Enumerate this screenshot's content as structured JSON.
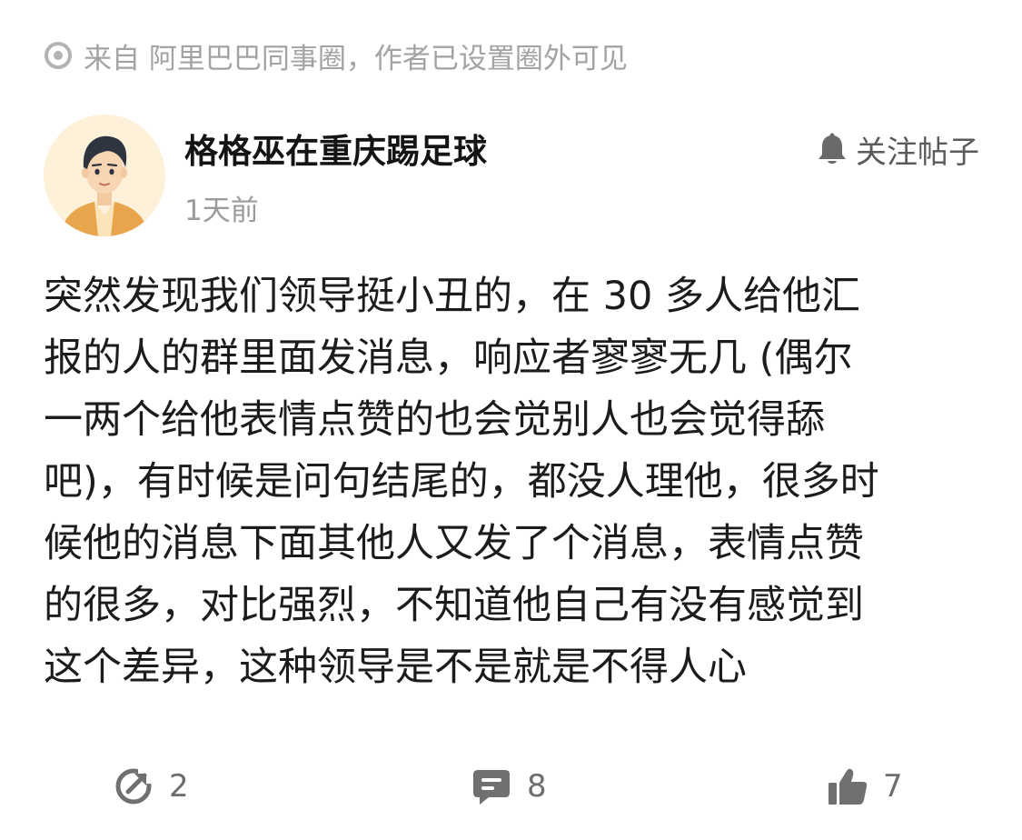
{
  "source": {
    "text": "来自 阿里巴巴同事圈，作者已设置圈外可见",
    "icon": "circle-dot-icon"
  },
  "post": {
    "author_name": "格格巫在重庆踢足球",
    "time": "1天前",
    "follow_label": "关注帖子",
    "avatar_icon": "avatar-icon",
    "body_lines": [
      "突然发现我们领导挺小丑的，在 30 多人给他汇",
      "报的人的群里面发消息，响应者寥寥无几 (偶尔",
      "一两个给他表情点赞的也会觉别人也会觉得舔",
      "吧)，有时候是问句结尾的，都没人理他，很多时",
      "候他的消息下面其他人又发了个消息，表情点赞",
      "的很多，对比强烈，不知道他自己有没有感觉到",
      "这个差异，这种领导是不是就是不得人心"
    ]
  },
  "actions": {
    "share_count": "2",
    "comment_count": "8",
    "like_count": "7"
  },
  "colors": {
    "muted": "#a3a3a3",
    "text": "#1c1c1c",
    "icon": "#707070",
    "avatar_bg": "#fdf1d9"
  }
}
